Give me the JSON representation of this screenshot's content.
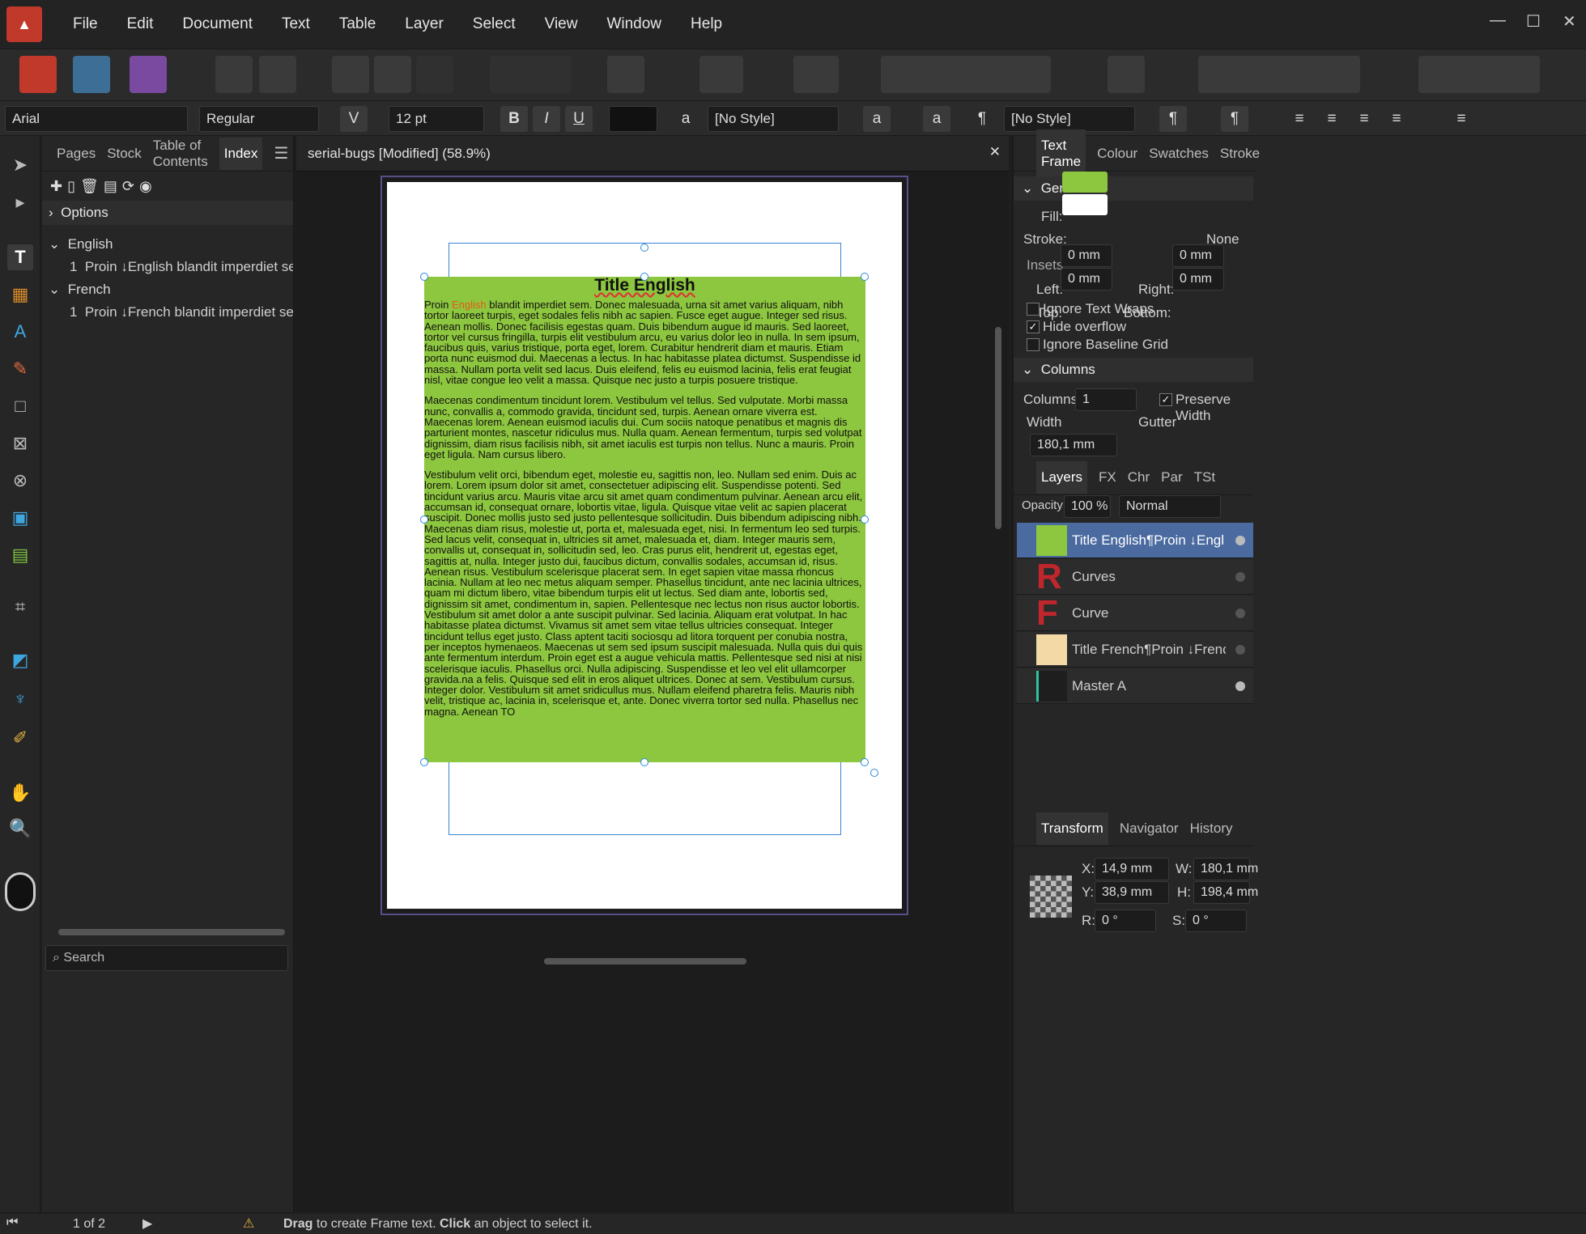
{
  "menu": [
    "File",
    "Edit",
    "Document",
    "Text",
    "Table",
    "Layer",
    "Select",
    "View",
    "Window",
    "Help"
  ],
  "textbar": {
    "font": "Arial",
    "style": "Regular",
    "size": "12 pt",
    "bold": "B",
    "italic": "I",
    "underline": "U",
    "para_style": "[No Style]",
    "char_style": "[No Style]"
  },
  "left_panel": {
    "tabs": [
      "Pages",
      "Stock",
      "Table of Contents",
      "Index"
    ],
    "options": "Options",
    "groups": [
      {
        "name": "English",
        "entry_num": "1",
        "entry": "Proin ↓English blandit imperdiet sem. D"
      },
      {
        "name": "French",
        "entry_num": "1",
        "entry": "Proin ↓French blandit imperdiet sem. Do"
      }
    ],
    "search_placeholder": "Search"
  },
  "document": {
    "tab_title": "serial-bugs [Modified] (58.9%)",
    "frame_title": "Title English",
    "para1_lead": "Proin ",
    "para1_highlight": "English",
    "para1_rest": " blandit imperdiet sem. Donec malesuada, urna sit amet varius aliquam, nibh tortor laoreet turpis, eget sodales felis nibh ac sapien. Fusce eget augue. Integer sed risus. Aenean mollis. Donec facilisis egestas quam. Duis bibendum augue id mauris. Sed laoreet, tortor vel cursus fringilla, turpis elit vestibulum arcu, eu varius dolor leo in nulla. In sem ipsum, faucibus quis, varius tristique, porta eget, lorem. Curabitur hendrerit diam et mauris. Etiam porta nunc euismod dui. Maecenas a lectus. In hac habitasse platea dictumst. Suspendisse id massa. Nullam porta velit sed lacus. Duis eleifend, felis eu euismod lacinia, felis erat feugiat nisl, vitae congue leo velit a massa. Quisque nec justo a turpis posuere tristique.",
    "para2": "Maecenas condimentum tincidunt lorem. Vestibulum vel tellus. Sed vulputate. Morbi massa nunc, convallis a, commodo gravida, tincidunt sed, turpis. Aenean ornare viverra est. Maecenas lorem. Aenean euismod iaculis dui. Cum sociis natoque penatibus et magnis dis parturient montes, nascetur ridiculus mus. Nulla quam. Aenean fermentum, turpis sed volutpat dignissim, diam risus facilisis nibh, sit amet iaculis est turpis non tellus. Nunc a mauris. Proin eget ligula. Nam cursus libero.",
    "para3": "Vestibulum velit orci, bibendum eget, molestie eu, sagittis non, leo. Nullam sed enim. Duis ac lorem. Lorem ipsum dolor sit amet, consectetuer adipiscing elit. Suspendisse potenti. Sed tincidunt varius arcu. Mauris vitae arcu sit amet quam condimentum pulvinar. Aenean arcu elit, accumsan id, consequat ornare, lobortis vitae, ligula. Quisque vitae velit ac sapien placerat suscipit. Donec mollis justo sed justo pellentesque sollicitudin. Duis bibendum adipiscing nibh. Maecenas diam risus, molestie ut, porta et, malesuada eget, nisi. In fermentum leo sed turpis. Sed lacus velit, consequat in, ultricies sit amet, malesuada et, diam. Integer mauris sem, convallis ut, consequat in, sollicitudin sed, leo. Cras purus elit, hendrerit ut, egestas eget, sagittis at, nulla. Integer justo dui, faucibus dictum, convallis sodales, accumsan id, risus. Aenean risus. Vestibulum scelerisque placerat sem. In eget sapien vitae massa rhoncus lacinia. Nullam at leo nec metus aliquam semper. Phasellus tincidunt, ante nec lacinia ultrices, quam mi dictum libero, vitae bibendum turpis elit ut lectus. Sed diam ante, lobortis sed, dignissim sit amet, condimentum in, sapien. Pellentesque nec lectus non risus auctor lobortis. Vestibulum sit amet dolor a ante suscipit pulvinar. Sed lacinia. Aliquam erat volutpat. In hac habitasse platea dictumst. Vivamus sit amet sem vitae tellus ultricies consequat. Integer tincidunt tellus eget justo. Class aptent taciti sociosqu ad litora torquent per conubia nostra, per inceptos hymenaeos. Maecenas ut sem sed ipsum suscipit malesuada. Nulla quis dui quis ante fermentum interdum. Proin eget est a augue vehicula mattis. Pellentesque sed nisi at nisi scelerisque iaculis. Phasellus orci. Nulla adipiscing. Suspendisse et leo vel elit ullamcorper gravida.na a felis. Quisque sed elit in eros aliquet ultrices. Donec at sem. Vestibulum cursus. Integer dolor. Vestibulum sit amet sridicullus mus. Nullam eleifend pharetra felis. Mauris nibh velit, tristique ac, lacinia in, scelerisque et, ante. Donec viverra tortor sed nulla. Phasellus nec magna. Aenean TO"
  },
  "right_panel": {
    "tabs": [
      "Text Frame",
      "Colour",
      "Swatches",
      "Stroke"
    ],
    "general": "General",
    "fill_label": "Fill:",
    "stroke_label": "Stroke:",
    "stroke_value": "None",
    "insets": "Insets",
    "left_label": "Left:",
    "left_val": "0 mm",
    "right_label": "Right:",
    "right_val": "0 mm",
    "top_label": "Top:",
    "top_val": "0 mm",
    "bottom_label": "Bottom:",
    "bottom_val": "0 mm",
    "ignore_wraps": "Ignore Text Wraps",
    "hide_overflow": "Hide overflow",
    "ignore_baseline": "Ignore Baseline Grid",
    "columns_head": "Columns",
    "columns_label": "Columns:",
    "columns_val": "1",
    "preserve_width": "Preserve Width",
    "width_label": "Width",
    "gutter_label": "Gutter",
    "width_val": "180,1 mm",
    "fill_color": "#8dc63f"
  },
  "layers_panel": {
    "tabs": [
      "Layers",
      "FX",
      "Chr",
      "Par",
      "TSt"
    ],
    "opacity_label": "Opacity:",
    "opacity_val": "100 %",
    "blend": "Normal",
    "layers": [
      "Title English¶Proin ↓Engl",
      "Curves",
      "Curve",
      "Title French¶Proin ↓Frenc",
      "Master A"
    ]
  },
  "transform_panel": {
    "tabs": [
      "Transform",
      "Navigator",
      "History"
    ],
    "x_label": "X:",
    "x_val": "14,9 mm",
    "y_label": "Y:",
    "y_val": "38,9 mm",
    "w_label": "W:",
    "w_val": "180,1 mm",
    "h_label": "H:",
    "h_val": "198,4 mm",
    "r_label": "R:",
    "r_val": "0 °",
    "s_label": "S:",
    "s_val": "0 °"
  },
  "status": {
    "page": "1 of 2",
    "drag": "Drag",
    "drag_rest": " to create Frame text. ",
    "click": "Click",
    "click_rest": " an object to select it."
  }
}
